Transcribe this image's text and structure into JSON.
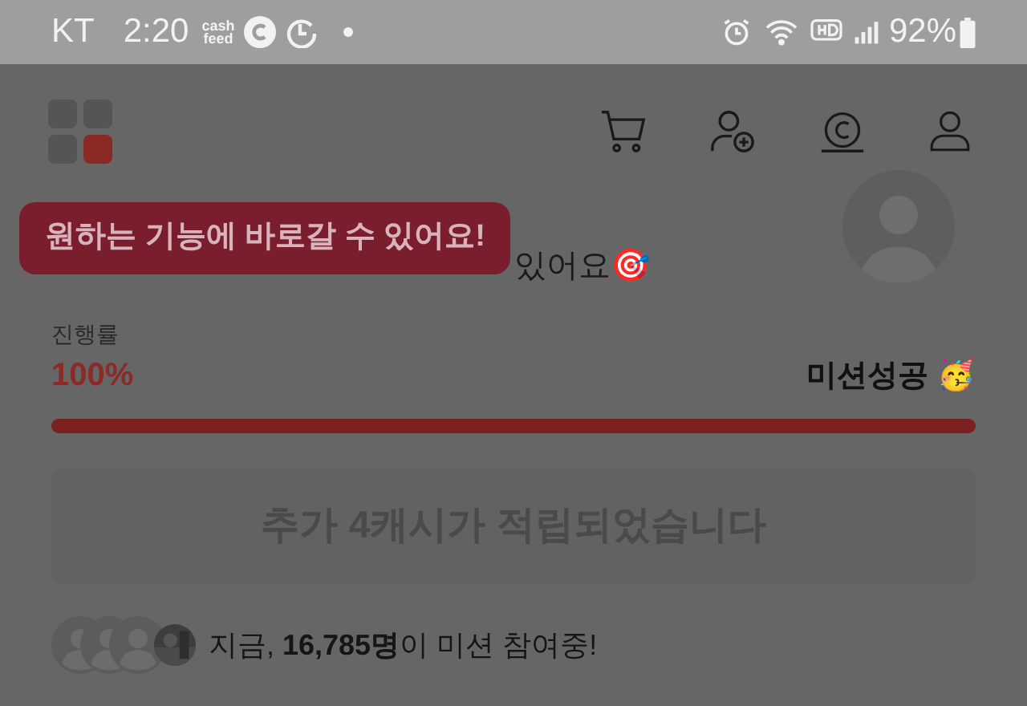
{
  "status_bar": {
    "carrier": "KT",
    "time": "2:20",
    "app_badge": [
      "cash",
      "feed"
    ],
    "battery": "92%"
  },
  "tooltip": {
    "text": "원하는 기능에 바로갈 수 있어요!"
  },
  "subtitle": {
    "text": "있어요🎯"
  },
  "progress": {
    "label": "진행률",
    "percent": "100%",
    "level": 1,
    "status": "미션성공 🥳"
  },
  "reward_button": {
    "label": "추가 4캐시가 적립되었습니다",
    "disabled": true
  },
  "participants": {
    "text": "지금, **16,785명**이 미션 참여중!"
  }
}
